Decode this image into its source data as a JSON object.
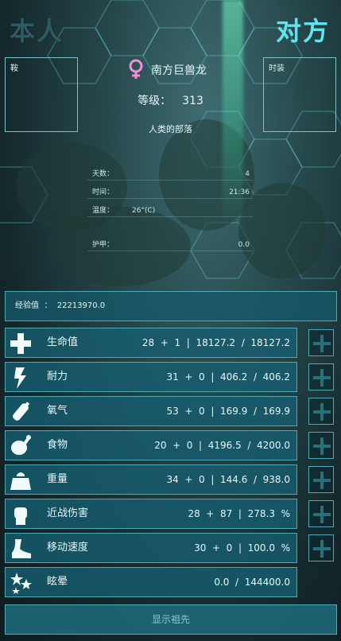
{
  "header": {
    "self_label": "本人",
    "opponent_label": "对方"
  },
  "equipment": {
    "left_slot_label": "鞍",
    "right_slot_label": "时装"
  },
  "creature": {
    "gender_icon": "female-symbol-icon",
    "gender_color": "#f08fd8",
    "name": "南方巨兽龙",
    "level_label": "等级：",
    "level_value": "313",
    "tribe": "人类的部落"
  },
  "info": {
    "days_label": "天数：",
    "days_value": "4",
    "time_label": "时间：",
    "time_value": "21:36",
    "temp_label": "温度：",
    "temp_value": "26°(C)",
    "armor_label": "护甲：",
    "armor_value": "0.0"
  },
  "xp": {
    "label": "经验值",
    "separator": "：",
    "value": "22213970.0"
  },
  "stats": [
    {
      "name": "生命值",
      "icon": "health-cross-icon",
      "vals": "28  +  1  |  18127.2  /  18127.2"
    },
    {
      "name": "耐力",
      "icon": "stamina-bolt-icon",
      "vals": "31  +  0  |  406.2  /  406.2"
    },
    {
      "name": "氧气",
      "icon": "oxygen-tank-icon",
      "vals": "53  +  0  |  169.9  /  169.9"
    },
    {
      "name": "食物",
      "icon": "food-meat-icon",
      "vals": "20  +  0  |  4196.5  /  4200.0"
    },
    {
      "name": "重量",
      "icon": "weight-icon",
      "vals": "34  +  0  |  144.6  /  938.0"
    },
    {
      "name": "近战伤害",
      "icon": "melee-fist-icon",
      "vals": "28  +  87  |  278.3  %"
    },
    {
      "name": "移动速度",
      "icon": "movement-boot-icon",
      "vals": "30  +  0  |  100.0  %"
    },
    {
      "name": "眩晕",
      "icon": "torpor-stars-icon",
      "vals": "0.0  /  144400.0"
    }
  ],
  "ancestors_button": "显示祖先",
  "colors": {
    "accent": "#5fe3ee",
    "panel": "#165e70",
    "border": "#4ea9b8"
  }
}
